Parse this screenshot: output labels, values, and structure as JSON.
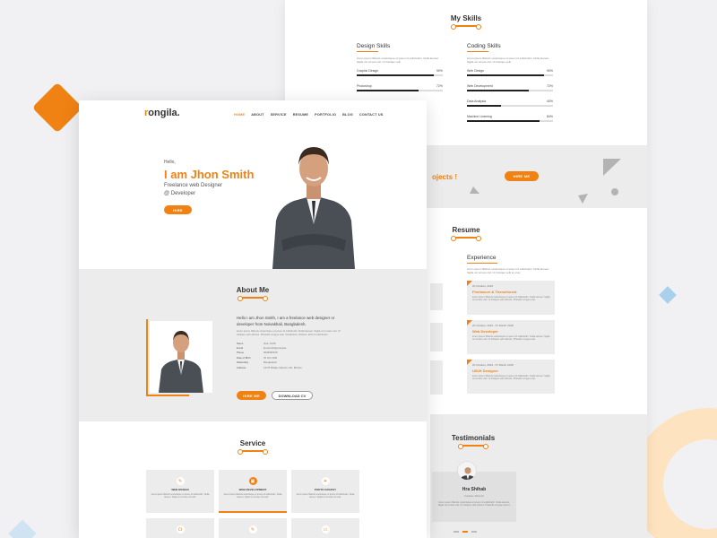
{
  "colors": {
    "accent": "#f08213",
    "panel": "#ececec",
    "dark": "#222222"
  },
  "skills": {
    "title": "My Skills",
    "design": {
      "heading": "Design Skills",
      "desc": "lorem ipsum fillaruls scelerisque ut ipsum id sollicitudin. Nulla laoreet. Sigila vel ornare nisl. Ut tristique velit",
      "items": [
        {
          "name": "Graphic Design",
          "label": "90%",
          "value": 90
        },
        {
          "name": "Photoshop",
          "label": "72%",
          "value": 72
        }
      ]
    },
    "coding": {
      "heading": "Coding Skills",
      "desc": "lorem ipsum fillaruls scelerisque ut ipsum id sollicitudin. Nulla laoreet. Sigila vel ornare nisl. Ut tristique velit",
      "items": [
        {
          "name": "Web Design",
          "label": "90%",
          "value": 90
        },
        {
          "name": "Web Development",
          "label": "72%",
          "value": 72
        },
        {
          "name": "Data Analysis",
          "label": "40%",
          "value": 40
        },
        {
          "name": "Machine Learning",
          "label": "84%",
          "value": 84
        }
      ]
    }
  },
  "projects": {
    "text": "ojects !",
    "button": "HIRE ME"
  },
  "resume": {
    "title": "Resume",
    "experience": {
      "heading": "Experience",
      "desc": "lorem ipsum fillaruls scelerisque ut ipsum id sollicitudin. Nulla laoreet. Sigila vel ornare nisl. Ut tristique velit et eros.",
      "items": [
        {
          "date": "20 October, 2019",
          "role": "Freelancer & Themeforest",
          "text": "lorem ipsum fillaruls scelerisque ut ipsum id sollicitudin. Nulla laoreet. Sigila vel ornare nisl. Ut tristique velit ultrices. Phasells congue erat."
        },
        {
          "date": "20 October, 2019 - 07 March 2018",
          "role": "Web Developer",
          "text": "lorem ipsum fillaruls scelerisque ut ipsum id sollicitudin. Nulla laoreet. Sigila vel ornare nisl. Ut tristique velit ultrices. Phasells congue erat."
        },
        {
          "date": "20 October, 2019 - 07 March 2018",
          "role": "UI/UX Designer",
          "text": "lorem ipsum fillaruls scelerisque ut ipsum id sollicitudin. Nulla laoreet. Sigila vel ornare nisl. Ut tristique velit ultrices. Phasells congue erat."
        }
      ]
    }
  },
  "testimonials": {
    "title": "Testimonials",
    "name": "Hra Shihab",
    "role": "Creative Director",
    "text": "lorem ipsum fillaruls scelerisque ut ipsum id sollicitudin. Nulla laoreet. Sigila vel ornare nisl. Ut tristique velit ultrices. Phasells congue erat et."
  },
  "front": {
    "logo_mark": "r",
    "logo_text": "ongila.",
    "nav": [
      "HOME",
      "ABOUT",
      "SERVICE",
      "RESUME",
      "PORTFOLIO",
      "BLOG",
      "CONTACT US"
    ],
    "hero": {
      "hello": "Hello,",
      "name": "I am Jhon Smith",
      "role_line1": "Freelance web Designer",
      "role_line2": "@ Developer",
      "button": "HIRE"
    },
    "about": {
      "title": "About Me",
      "lead": "Hello I am Jhon Smith, I am a freelance web designer or developer from Noivakhali, Bangladesh.",
      "small": "lorem ipsum fillaruls scelerisque ut ipsum id sollicitudin. Nulla laoreet. Sigila vel ornare nisl. Ut tristique velit ultrices. Phasells congue erat. Vestibulum ultricies, felis id sollicitudin.",
      "info": [
        {
          "k": "Name",
          "v": "Jhon Smith"
        },
        {
          "k": "Email",
          "v": "jhonsmith@example"
        },
        {
          "k": "Phone",
          "v": "0036583078"
        },
        {
          "k": "Date of Birth",
          "v": "25 Oct 1990"
        },
        {
          "k": "Nationality",
          "v": "Bangladesh"
        },
        {
          "k": "Address",
          "v": "127/8 Dhaka, Mirpurn, Mo. Birshre"
        }
      ],
      "btn_hire": "HIRE ME",
      "btn_cv": "DOWNLOAD CV"
    },
    "service": {
      "title": "Service",
      "items": [
        {
          "title": "WEB DESIGN",
          "icon": "✎",
          "desc": "lorem ipsum fillaruls scelerisque ut ipsum id sollicitudin. Nulla laoreet. Sigila vel ornare nisl velit."
        },
        {
          "title": "WEB DEVELOPMENT",
          "icon": "▣",
          "desc": "lorem ipsum fillaruls scelerisque ut ipsum id sollicitudin. Nulla laoreet. Sigila vel ornare nisl velit."
        },
        {
          "title": "PHOTO GRAPHY",
          "icon": "✦",
          "desc": "lorem ipsum fillaruls scelerisque ut ipsum id sollicitudin. Nulla laoreet. Sigila vel ornare nisl velit."
        }
      ]
    }
  }
}
